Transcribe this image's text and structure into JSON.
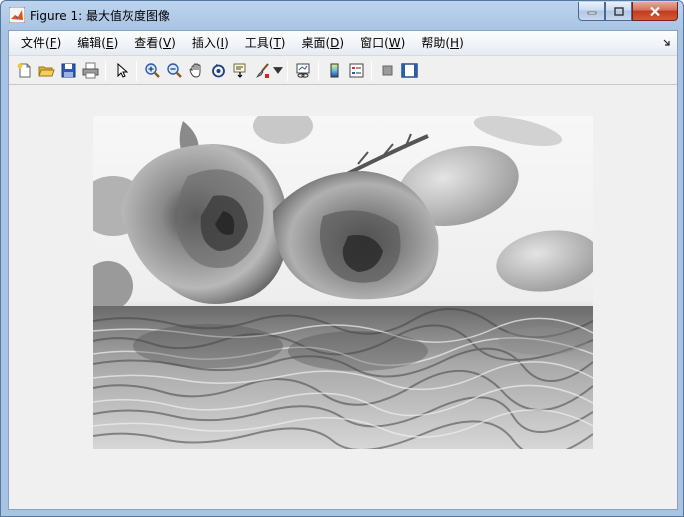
{
  "window": {
    "title": "Figure 1: 最大值灰度图像"
  },
  "menu": [
    {
      "name": "menu-file",
      "label": "文件(",
      "acc": "F",
      "tail": ")"
    },
    {
      "name": "menu-edit",
      "label": "编辑(",
      "acc": "E",
      "tail": ")"
    },
    {
      "name": "menu-view",
      "label": "查看(",
      "acc": "V",
      "tail": ")"
    },
    {
      "name": "menu-insert",
      "label": "插入(",
      "acc": "I",
      "tail": ")"
    },
    {
      "name": "menu-tools",
      "label": "工具(",
      "acc": "T",
      "tail": ")"
    },
    {
      "name": "menu-desktop",
      "label": "桌面(",
      "acc": "D",
      "tail": ")"
    },
    {
      "name": "menu-window",
      "label": "窗口(",
      "acc": "W",
      "tail": ")"
    },
    {
      "name": "menu-help",
      "label": "帮助(",
      "acc": "H",
      "tail": ")"
    }
  ],
  "toolbar": [
    "new-figure-icon",
    "open-file-icon",
    "save-icon",
    "print-icon",
    "edit-plot-arrow-icon",
    "zoom-in-icon",
    "zoom-out-icon",
    "pan-hand-icon",
    "rotate-3d-icon",
    "data-cursor-icon",
    "brush-icon",
    "link-plot-icon",
    "insert-colorbar-icon",
    "insert-legend-icon",
    "hide-plot-tools-icon",
    "show-plot-tools-icon"
  ],
  "image": {
    "description_colormap": "gray"
  }
}
